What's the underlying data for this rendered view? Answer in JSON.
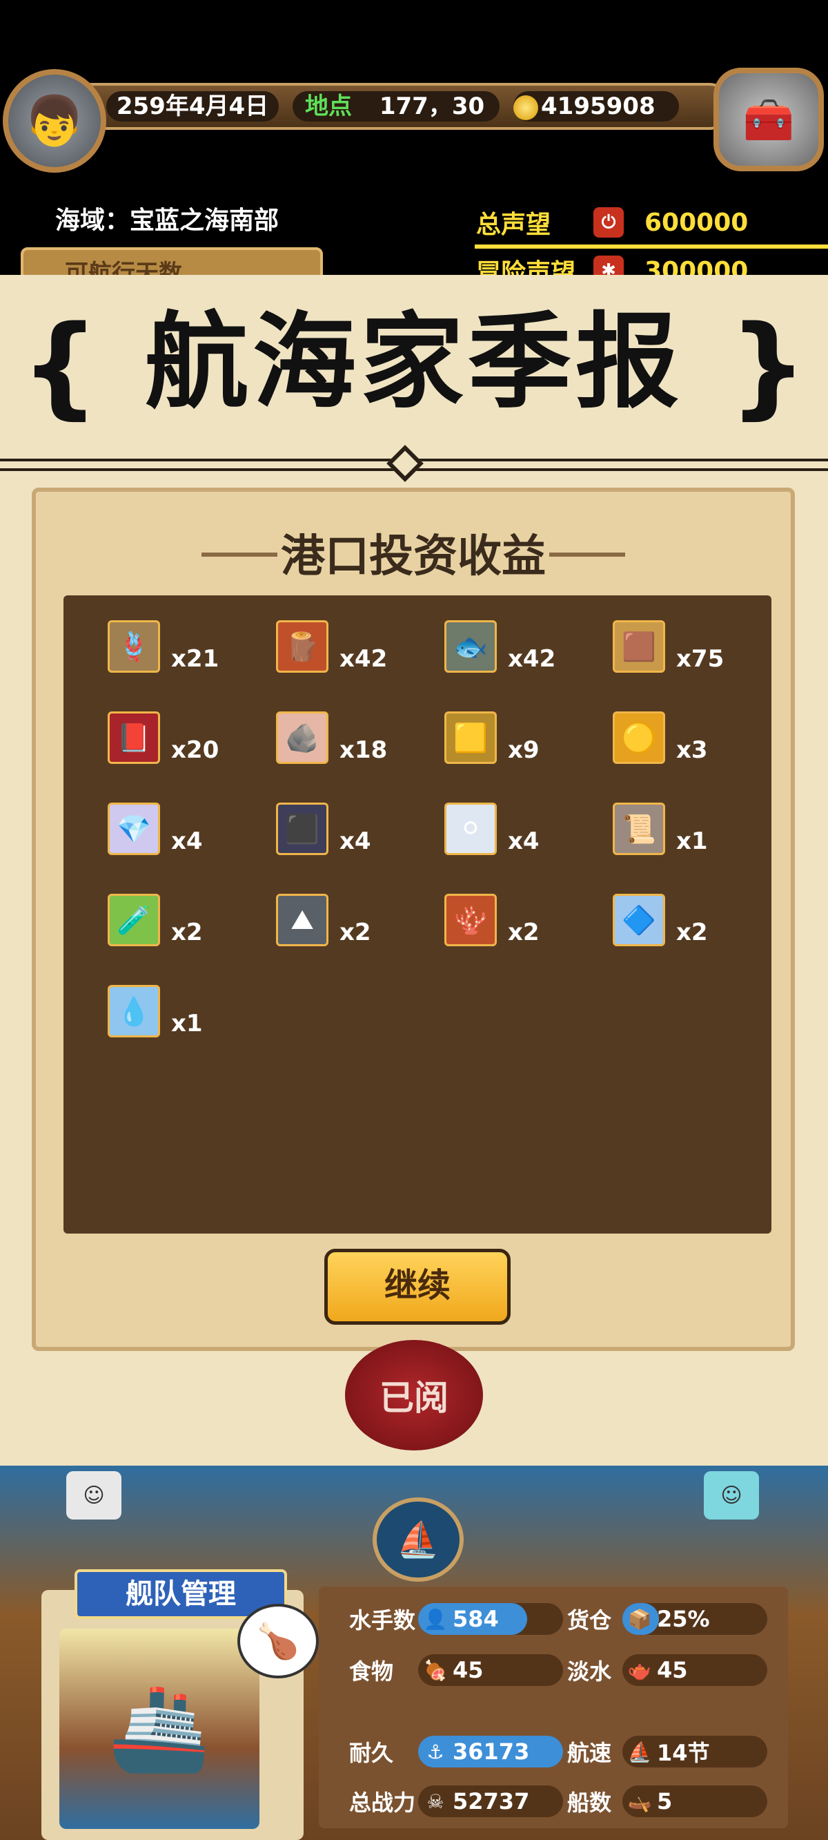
{
  "hud": {
    "date": "259年4月4日",
    "location_label": "地点",
    "location_value": "177，30",
    "gold": "4195908",
    "sea_area": "海域：宝蓝之海南部",
    "days_label": "可航行天数",
    "total_rep_label": "总声望",
    "total_rep_value": "600000",
    "adv_rep_label": "冒险声望",
    "adv_rep_value": "300000"
  },
  "report": {
    "title": "航海家季报",
    "brace_left": "{",
    "brace_right": "}",
    "section_title": "港口投资收益",
    "continue_label": "继续",
    "seal_label": "已阅",
    "items": [
      {
        "icon": "rope-icon",
        "glyph": "🪢",
        "qty": "x21",
        "color": "#a08050"
      },
      {
        "icon": "wood-plank-icon",
        "glyph": "🪵",
        "qty": "x42",
        "color": "#c0502a"
      },
      {
        "icon": "fishbone-icon",
        "glyph": "🐟",
        "qty": "x42",
        "color": "#6e7a6a"
      },
      {
        "icon": "lumber-icon",
        "glyph": "🟫",
        "qty": "x75",
        "color": "#c99a4a"
      },
      {
        "icon": "book-icon",
        "glyph": "📕",
        "qty": "x20",
        "color": "#a8232a"
      },
      {
        "icon": "stone-icon",
        "glyph": "🪨",
        "qty": "x18",
        "color": "#e6b7a6"
      },
      {
        "icon": "gold-bar-icon",
        "glyph": "🟨",
        "qty": "x9",
        "color": "#b68d2a"
      },
      {
        "icon": "gold-nugget-icon",
        "glyph": "🟡",
        "qty": "x3",
        "color": "#e6a11e"
      },
      {
        "icon": "crystal-icon",
        "glyph": "💎",
        "qty": "x4",
        "color": "#cfc9ef"
      },
      {
        "icon": "slate-icon",
        "glyph": "⬛",
        "qty": "x4",
        "color": "#3e3e5a"
      },
      {
        "icon": "pearl-icon",
        "glyph": "⚪",
        "qty": "x4",
        "color": "#dfe8f2"
      },
      {
        "icon": "cloth-stack-icon",
        "glyph": "📜",
        "qty": "x1",
        "color": "#9a8a80"
      },
      {
        "icon": "potion-icon",
        "glyph": "🧪",
        "qty": "x2",
        "color": "#7fc24a"
      },
      {
        "icon": "iron-ore-icon",
        "glyph": "⛰",
        "qty": "x2",
        "color": "#5a6068"
      },
      {
        "icon": "coral-icon",
        "glyph": "🪸",
        "qty": "x2",
        "color": "#c05028"
      },
      {
        "icon": "ice-crystal-icon",
        "glyph": "🔷",
        "qty": "x2",
        "color": "#9ec7f0"
      },
      {
        "icon": "water-drop-icon",
        "glyph": "💧",
        "qty": "x1",
        "color": "#8fc6f0"
      }
    ]
  },
  "fleet": {
    "label": "舰队管理",
    "sailors_label": "水手数",
    "sailors_value": "584",
    "sailors_fill": 0.75,
    "cargo_label": "货仓",
    "cargo_value": "25%",
    "cargo_fill": 0.25,
    "food_label": "食物",
    "food_value": "45",
    "water_label": "淡水",
    "water_value": "45",
    "durability_label": "耐久",
    "durability_value": "36173",
    "durability_fill": 1.0,
    "speed_label": "航速",
    "speed_value": "14节",
    "power_label": "总战力",
    "power_value": "52737",
    "ships_label": "船数",
    "ships_value": "5"
  },
  "colors": {
    "parchment": "#efe3c2",
    "panel": "#543a21",
    "accent_yellow": "#ffde3a",
    "button": "#f0a81c"
  }
}
